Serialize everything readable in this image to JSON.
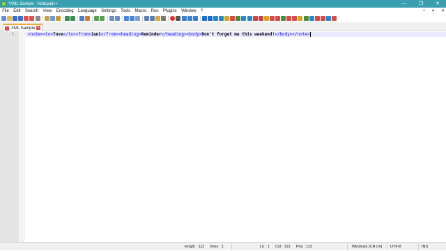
{
  "window": {
    "title": "*XML Sample - Notepad++",
    "minimize_glyph": "—",
    "maximize_glyph": "❐",
    "close_glyph": "✕",
    "accent": "#3aa0b0"
  },
  "menubar": {
    "items": [
      "File",
      "Edit",
      "Search",
      "View",
      "Encoding",
      "Language",
      "Settings",
      "Tools",
      "Macro",
      "Run",
      "Plugins",
      "Window",
      "?"
    ],
    "right_items": [
      "+",
      "▾",
      "✕"
    ]
  },
  "toolbar": {
    "icons": [
      "new-file-icon",
      "open-file-icon",
      "save-icon",
      "save-all-icon",
      "close-icon",
      "close-all-icon",
      "print-icon",
      "cut-icon",
      "copy-icon",
      "paste-icon",
      "undo-icon",
      "redo-icon",
      "find-icon",
      "replace-icon",
      "zoom-in-icon",
      "zoom-out-icon",
      "sync-v-icon",
      "sync-h-icon",
      "word-wrap-icon",
      "show-all-chars-icon",
      "indent-guide-icon",
      "doc-map-icon",
      "function-list-icon",
      "folder-workspace-icon",
      "monitoring-icon",
      "record-macro-icon",
      "stop-record-icon",
      "play-macro-icon",
      "run-macro-multiple-icon",
      "save-macro-icon"
    ]
  },
  "tab": {
    "label": "XML Sample",
    "close_glyph": "×"
  },
  "editor": {
    "line_number": "1",
    "code": [
      {
        "t": "tag",
        "v": "<note>"
      },
      {
        "t": "tag",
        "v": "<to>"
      },
      {
        "t": "text",
        "v": "Tove"
      },
      {
        "t": "tag",
        "v": "</to>"
      },
      {
        "t": "tag",
        "v": "<from>"
      },
      {
        "t": "text",
        "v": "Jani"
      },
      {
        "t": "tag",
        "v": "</from>"
      },
      {
        "t": "tag",
        "v": "<heading>"
      },
      {
        "t": "text",
        "v": "Reminder"
      },
      {
        "t": "tag",
        "v": "</heading>"
      },
      {
        "t": "tag",
        "v": "<body>"
      },
      {
        "t": "text",
        "v": "Don't forget me this weekend!"
      },
      {
        "t": "tag",
        "v": "</body>"
      },
      {
        "t": "tag",
        "v": "</note>"
      }
    ]
  },
  "status": {
    "length": "length : 112",
    "lines": "lines : 1",
    "ln": "Ln : 1",
    "col": "Col : 113",
    "pos": "Pos : 113",
    "eol": "Windows (CR LF)",
    "encoding": "UTF-8",
    "mode": "INS"
  }
}
